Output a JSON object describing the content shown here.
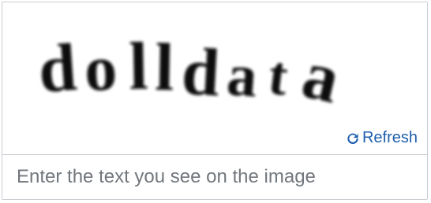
{
  "captcha": {
    "image_text": "dolldata",
    "refresh_label": "Refresh",
    "refresh_icon": "refresh-icon",
    "input_placeholder": "Enter the text you see on the image",
    "input_value": "",
    "colors": {
      "border": "#c8ccd1",
      "link": "#1f5fae",
      "placeholder": "#72777d",
      "captcha_ink": "#111111"
    }
  }
}
